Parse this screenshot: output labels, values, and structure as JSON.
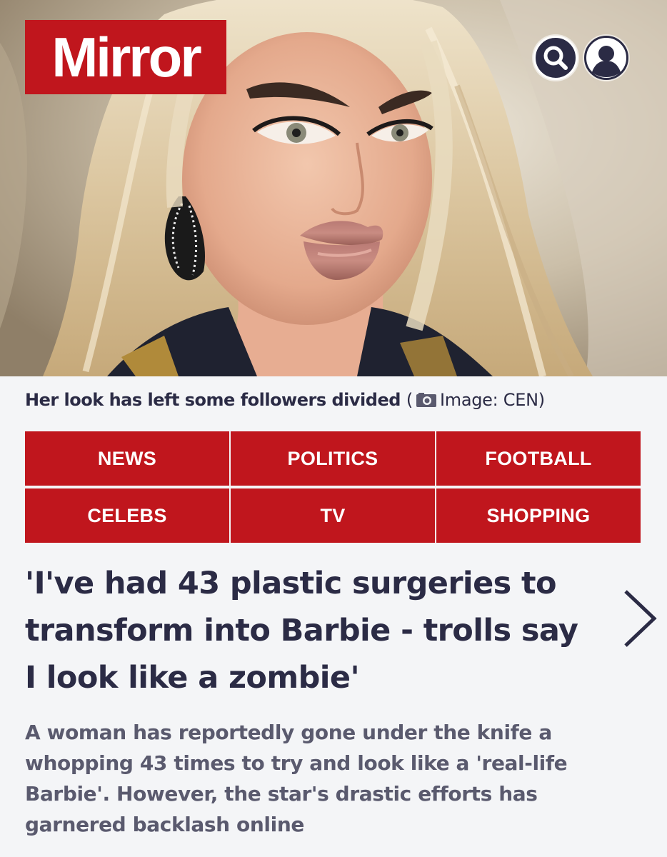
{
  "brand": {
    "logo_text": "Mirror",
    "logo_color": "#c0161d"
  },
  "header": {
    "search_icon": "search-icon",
    "account_icon": "account-icon"
  },
  "hero": {
    "caption": "Her look has left some followers divided",
    "credit_open": "(",
    "credit_icon": "camera-icon",
    "credit": "Image: CEN)"
  },
  "nav": {
    "items": [
      {
        "label": "NEWS"
      },
      {
        "label": "POLITICS"
      },
      {
        "label": "FOOTBALL"
      },
      {
        "label": "CELEBS"
      },
      {
        "label": "TV"
      },
      {
        "label": "SHOPPING"
      }
    ],
    "color": "#c0161d"
  },
  "article": {
    "headline": "'I've had 43 plastic surgeries to transform into Barbie - trolls say I look like a zombie'",
    "standfirst": "A woman has reportedly gone under the knife a whopping 43 times to try and look like a 'real-life Barbie'. However, the star's drastic efforts has garnered backlash online",
    "next_icon": "chevron-right-icon"
  },
  "colors": {
    "text": "#2b2b45",
    "muted": "#5a5a6e",
    "background": "#f4f5f7"
  }
}
